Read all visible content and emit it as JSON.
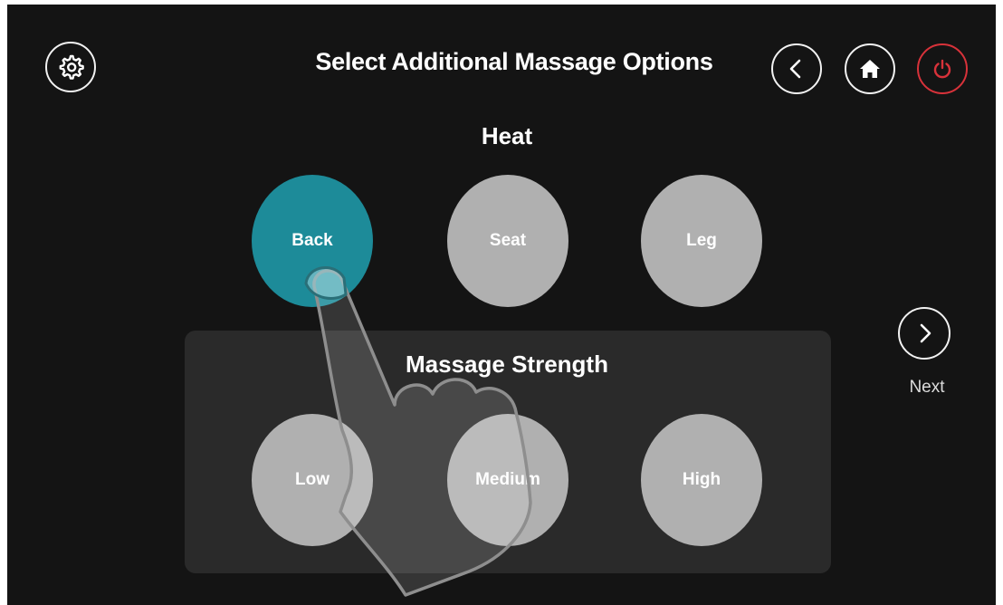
{
  "header": {
    "title": "Select Additional Massage Options",
    "settings_icon": "gear-icon",
    "back_icon": "chevron-left-icon",
    "home_icon": "home-icon",
    "power_icon": "power-icon"
  },
  "heat": {
    "title": "Heat",
    "options": [
      {
        "label": "Back",
        "selected": true
      },
      {
        "label": "Seat",
        "selected": false
      },
      {
        "label": "Leg",
        "selected": false
      }
    ]
  },
  "strength": {
    "title": "Massage Strength",
    "options": [
      {
        "label": "Low",
        "selected": false
      },
      {
        "label": "Medium",
        "selected": false
      },
      {
        "label": "High",
        "selected": false
      }
    ]
  },
  "next": {
    "label": "Next",
    "icon": "chevron-right-icon"
  },
  "colors": {
    "background": "#141414",
    "selected": "#1d8b99",
    "unselected": "#b0b0b0",
    "power": "#d8323a",
    "panel": "#2a2a2a"
  },
  "overlay": {
    "icon": "tap-hand-icon"
  }
}
